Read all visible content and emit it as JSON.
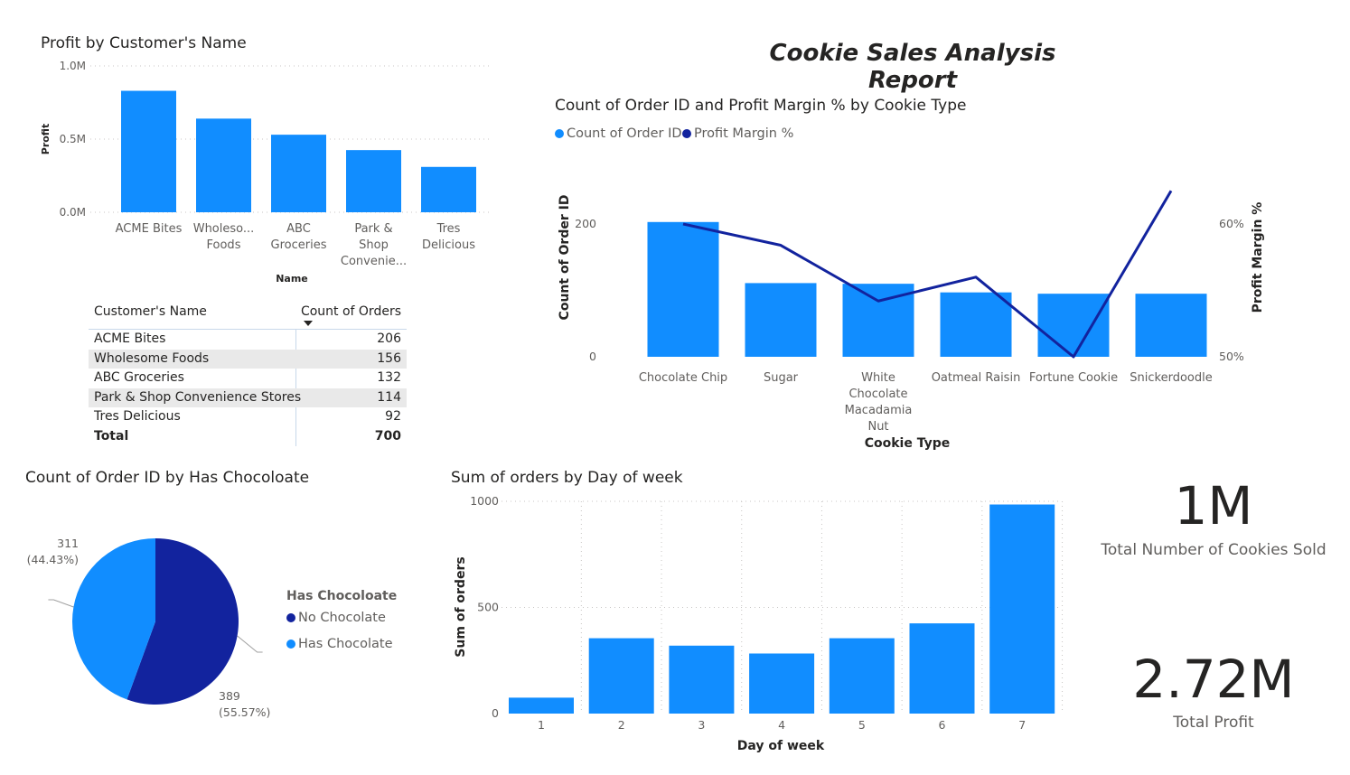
{
  "report_title": "Cookie Sales Analysis Report",
  "colors": {
    "blue": "#118dff",
    "navy": "#12239e",
    "grid": "#c8c6c4",
    "text": "#605e5c"
  },
  "chart_data": [
    {
      "id": "profit-by-customer",
      "type": "bar",
      "title": "Profit by Customer's Name",
      "xlabel": "Name",
      "ylabel": "Profit",
      "categories": [
        [
          "ACME Bites"
        ],
        [
          "Wholeso...",
          "Foods"
        ],
        [
          "ABC",
          "Groceries"
        ],
        [
          "Park &",
          "Shop",
          "Convenie..."
        ],
        [
          "Tres",
          "Delicious"
        ]
      ],
      "values": [
        830000,
        640000,
        530000,
        425000,
        310000
      ],
      "ylim": [
        0,
        1000000
      ],
      "yticks": [
        "0.0M",
        "0.5M",
        "1.0M"
      ],
      "grid": true
    },
    {
      "id": "orders-margin-by-cookie",
      "type": "bar",
      "title": "Count of Order ID and Profit Margin % by Cookie Type",
      "xlabel": "Cookie Type",
      "ylabel": "Count of Order ID",
      "y2label": "Profit Margin %",
      "legend": "top-left",
      "categories": [
        [
          "Chocolate Chip"
        ],
        [
          "Sugar"
        ],
        [
          "White",
          "Chocolate",
          "Macadamia",
          "Nut"
        ],
        [
          "Oatmeal Raisin"
        ],
        [
          "Fortune Cookie"
        ],
        [
          "Snickerdoodle"
        ]
      ],
      "series": [
        {
          "name": "Count of Order ID",
          "type": "bar",
          "values": [
            203,
            111,
            110,
            97,
            95,
            95
          ]
        },
        {
          "name": "Profit Margin %",
          "type": "line",
          "axis": "right",
          "values": [
            60.0,
            58.4,
            54.2,
            56.0,
            50.0,
            62.5
          ]
        }
      ],
      "ylim": [
        0,
        200
      ],
      "yticks": [
        "0",
        "200"
      ],
      "y2lim": [
        50,
        60
      ],
      "y2ticks": [
        "50%",
        "60%"
      ]
    },
    {
      "id": "orders-by-chocolate",
      "type": "pie",
      "title": "Count of Order ID by Has Chocoloate",
      "legend_title": "Has Chocoloate",
      "legend": "right",
      "slices": [
        {
          "name": "No Chocolate",
          "value": 389,
          "label": "389",
          "pct": "(55.57%)"
        },
        {
          "name": "Has Chocolate",
          "value": 311,
          "label": "311",
          "pct": "(44.43%)"
        }
      ]
    },
    {
      "id": "orders-by-day",
      "type": "bar",
      "title": "Sum of orders by Day of week",
      "xlabel": "Day of week",
      "ylabel": "Sum of orders",
      "categories": [
        "1",
        "2",
        "3",
        "4",
        "5",
        "6",
        "7"
      ],
      "values": [
        75,
        355,
        320,
        283,
        355,
        425,
        985
      ],
      "ylim": [
        0,
        1000
      ],
      "yticks": [
        "0",
        "500",
        "1000"
      ],
      "grid": true
    }
  ],
  "table": {
    "headers": [
      "Customer's Name",
      "Count of Orders"
    ],
    "rows": [
      [
        "ACME Bites",
        "206"
      ],
      [
        "Wholesome Foods",
        "156"
      ],
      [
        "ABC Groceries",
        "132"
      ],
      [
        "Park & Shop Convenience Stores",
        "114"
      ],
      [
        "Tres Delicious",
        "92"
      ]
    ],
    "total": [
      "Total",
      "700"
    ]
  },
  "cards": [
    {
      "value": "1M",
      "label": "Total Number of Cookies Sold"
    },
    {
      "value": "2.72M",
      "label": "Total Profit"
    }
  ]
}
